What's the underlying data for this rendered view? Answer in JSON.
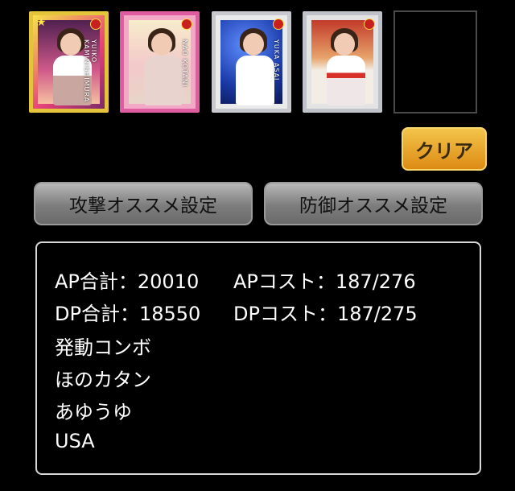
{
  "cards": [
    {
      "name_text": "YUIKO KAMINISHIMURA",
      "rarity_icon": "star-badge"
    },
    {
      "name_text": "NAO KOTANI",
      "rarity_icon": "badge"
    },
    {
      "name_text": "YUKA ASAI",
      "rarity_icon": "badge"
    },
    {
      "name_text": "",
      "rarity_icon": "badge"
    }
  ],
  "buttons": {
    "clear_label": "クリア",
    "attack_label": "攻撃オススメ設定",
    "defense_label": "防御オススメ設定"
  },
  "stats": {
    "ap_total": "AP合計：20010",
    "ap_cost": "APコスト：187/276",
    "dp_total": "DP合計：18550",
    "dp_cost": "DPコスト：187/275",
    "combo_heading": "発動コンボ",
    "combos": [
      "ほのカタン",
      "あゆうゆ",
      "USA"
    ]
  },
  "colors": {
    "clear_button": "#e8a62a",
    "preset_button": "#8c8c8c",
    "panel_border": "#d8d8d8"
  }
}
